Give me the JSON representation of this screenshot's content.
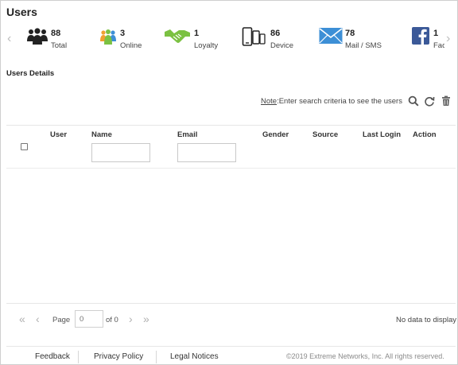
{
  "page": {
    "title": "Users",
    "section_title": "Users Details"
  },
  "stats": [
    {
      "icon": "users-group-icon",
      "value": "88",
      "label": "Total"
    },
    {
      "icon": "online-users-icon",
      "value": "3",
      "label": "Online"
    },
    {
      "icon": "handshake-icon",
      "value": "1",
      "label": "Loyalty"
    },
    {
      "icon": "devices-icon",
      "value": "86",
      "label": "Device"
    },
    {
      "icon": "mail-icon",
      "value": "78",
      "label": "Mail / SMS"
    },
    {
      "icon": "facebook-icon",
      "value": "1",
      "label": "Fac"
    }
  ],
  "toolbar": {
    "note_label": "Note",
    "note_text": ":Enter search criteria to see the users"
  },
  "table": {
    "columns": {
      "user": "User",
      "name": "Name",
      "email": "Email",
      "gender": "Gender",
      "source": "Source",
      "last_login": "Last Login",
      "action": "Action"
    },
    "name_filter": "",
    "email_filter": ""
  },
  "pager": {
    "page_label": "Page",
    "page_placeholder": "0",
    "of_label": "of 0",
    "status": "No data to display"
  },
  "footer": {
    "feedback": "Feedback",
    "privacy": "Privacy Policy",
    "legal": "Legal Notices",
    "copyright": "©2019 Extreme Networks, Inc. All rights reserved."
  },
  "colors": {
    "accent_green": "#7bc142",
    "mail_blue": "#3d8fd6",
    "facebook_blue": "#3b5998",
    "online_orange": "#f0a030",
    "icon_dark": "#222222"
  }
}
